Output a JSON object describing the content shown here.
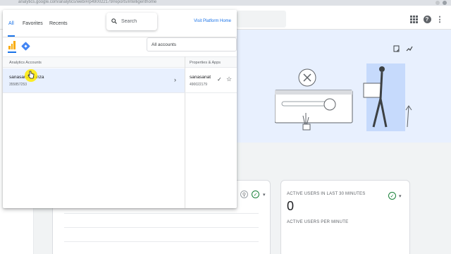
{
  "browser": {
    "url": "analytics.google.com/analytics/web/#/p490022179/reports/intelligenthome"
  },
  "header": {
    "apps_icon": "apps-grid-icon",
    "help_icon": "help-icon",
    "more_icon": "more-vert-icon"
  },
  "picker": {
    "tabs": [
      {
        "label": "All",
        "active": true
      },
      {
        "label": "Favorites",
        "active": false
      },
      {
        "label": "Recents",
        "active": false
      }
    ],
    "search_placeholder": "Search",
    "visit_link": "Visit Platform Home",
    "accounts_filter": "All accounts",
    "columns": {
      "accounts": "Analytics Accounts",
      "properties": "Properties & Apps"
    },
    "account": {
      "name": "sanasanat-kenza",
      "id": "355857253"
    },
    "property": {
      "name": "sanasanat",
      "id": "490022179"
    }
  },
  "realtime_card": {
    "title": "ACTIVE USERS IN LAST 30 MINUTES",
    "value": "0",
    "subtitle": "ACTIVE USERS PER MINUTE"
  },
  "colors": {
    "accent": "#1a73e8",
    "selected_row": "#e8f0fe",
    "ga_orange": "#f9ab00",
    "gtm_blue": "#4285f4",
    "hero_bg": "#e8f0fe",
    "status_green": "#188038"
  }
}
